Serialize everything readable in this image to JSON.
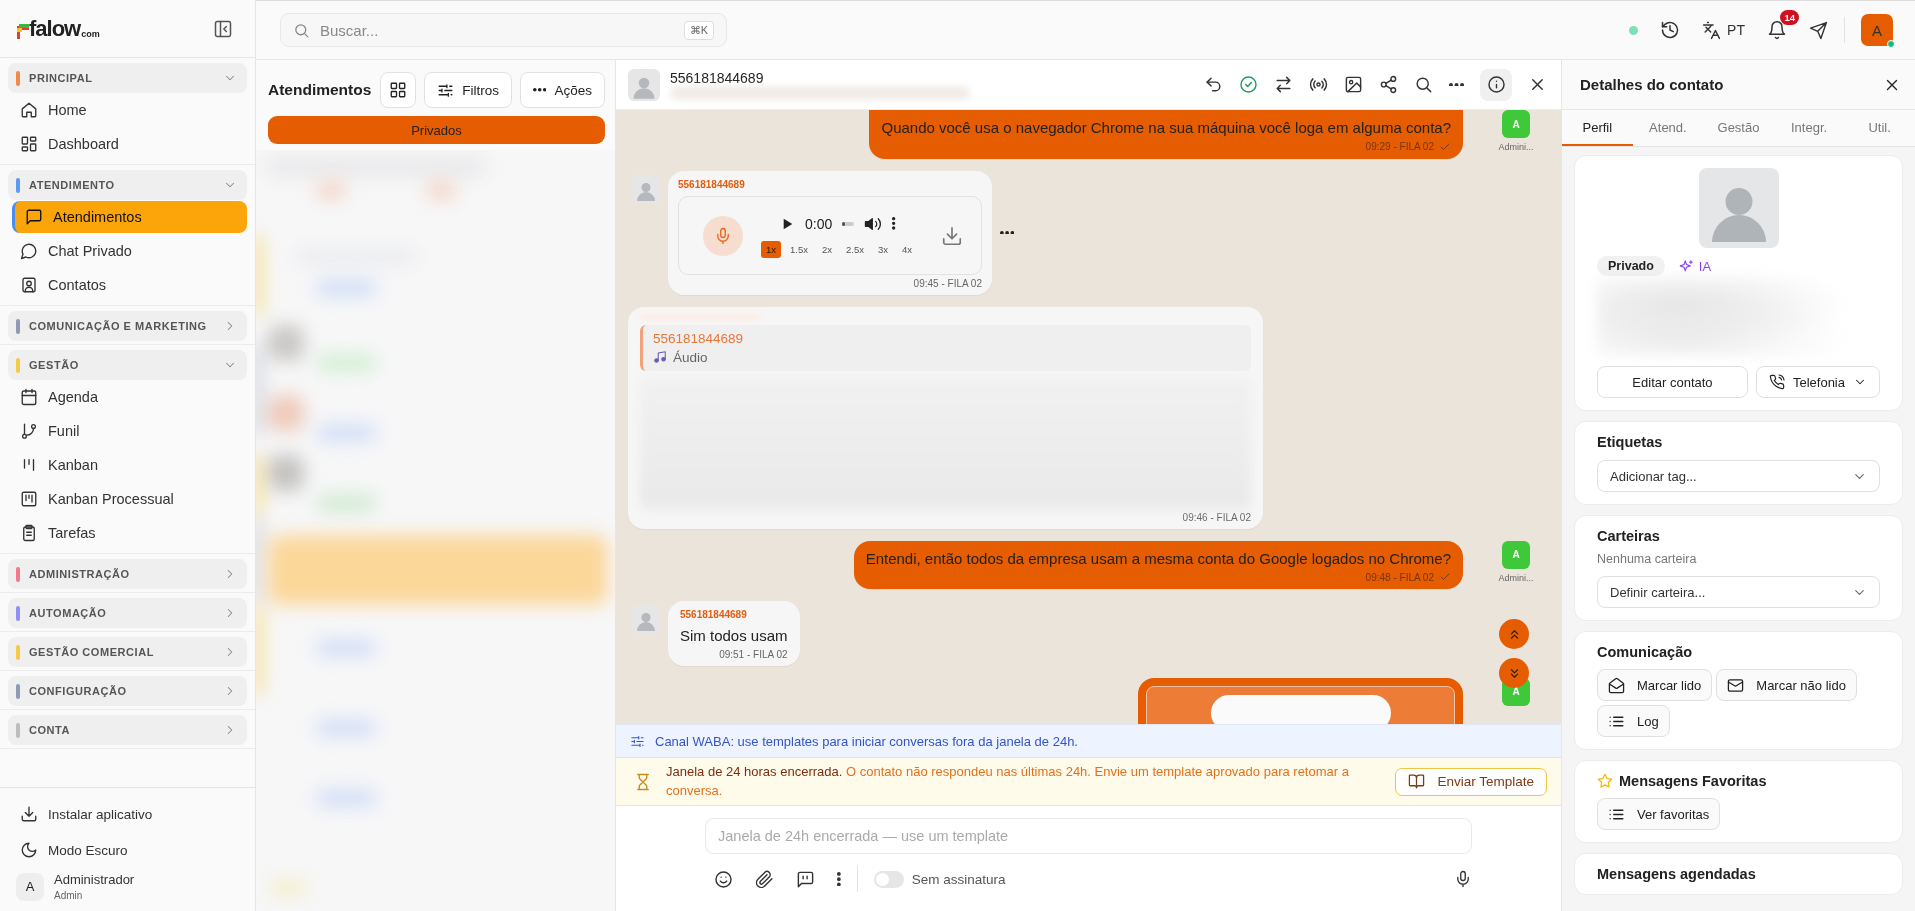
{
  "sidebar": {
    "logo": {
      "name": "falow",
      "suffix": "com"
    },
    "groups": [
      {
        "label": "PRINCIPAL",
        "color": "#f0894a",
        "expanded": true,
        "items": [
          {
            "label": "Home",
            "selected": false
          },
          {
            "label": "Dashboard",
            "selected": false
          }
        ]
      },
      {
        "label": "ATENDIMENTO",
        "color": "#5b9bf0",
        "expanded": true,
        "items": [
          {
            "label": "Atendimentos",
            "selected": true
          },
          {
            "label": "Chat Privado",
            "selected": false
          },
          {
            "label": "Contatos",
            "selected": false
          }
        ]
      },
      {
        "label": "COMUNICAÇÃO E MARKETING",
        "color": "#8d9bb3",
        "expanded": false
      },
      {
        "label": "GESTÃO",
        "color": "#f7c948",
        "expanded": true,
        "items": [
          {
            "label": "Agenda",
            "selected": false
          },
          {
            "label": "Funil",
            "selected": false
          },
          {
            "label": "Kanban",
            "selected": false
          },
          {
            "label": "Kanban Processual",
            "selected": false
          },
          {
            "label": "Tarefas",
            "selected": false
          }
        ]
      },
      {
        "label": "ADMINISTRAÇÃO",
        "color": "#f2788a",
        "expanded": false
      },
      {
        "label": "AUTOMAÇÃO",
        "color": "#8f8ff5",
        "expanded": false
      },
      {
        "label": "GESTÃO COMERCIAL",
        "color": "#f7c948",
        "expanded": false
      },
      {
        "label": "CONFIGURAÇÃO",
        "color": "#8d9bb3",
        "expanded": false
      },
      {
        "label": "CONTA",
        "color": "#bdbdbd",
        "expanded": false
      }
    ],
    "footer": [
      "Instalar aplicativo",
      "Modo Escuro"
    ],
    "user": {
      "initial": "A",
      "name": "Administrador",
      "role": "Admin"
    }
  },
  "topbar": {
    "search": {
      "placeholder": "Buscar...",
      "shortcut": "⌘K"
    },
    "language": "PT",
    "notifications": "14",
    "avatar": "A"
  },
  "conversations": {
    "title": "Atendimentos",
    "buttons": [
      "Filtros",
      "Ações"
    ],
    "filter": "Privados"
  },
  "chat": {
    "contact": "556181844689",
    "messages": [
      {
        "kind": "text_out",
        "text": "Quando você usa o navegador Chrome na sua máquina você loga em alguma conta?",
        "meta": "09:29 - FILA 02",
        "sent": true,
        "sender_initial": "A",
        "sender_label": "Admini..."
      },
      {
        "kind": "audio_in",
        "sender": "556181844689",
        "time": "0:00",
        "level": 0,
        "speeds": [
          {
            "label": "1x",
            "selected": true
          },
          {
            "label": "1.5x",
            "selected": false
          },
          {
            "label": "2x",
            "selected": false
          },
          {
            "label": "2.5x",
            "selected": false
          },
          {
            "label": "3x",
            "selected": false
          },
          {
            "label": "4x",
            "selected": false
          }
        ],
        "meta": "09:45 - FILA 02"
      },
      {
        "kind": "quote_in",
        "quote": {
          "sender": "556181844689",
          "text": "Áudio"
        },
        "meta": "09:46 - FILA 02"
      },
      {
        "kind": "text_out",
        "text": "Entendi, então todos da empresa usam a mesma conta do Google logados no Chrome?",
        "meta": "09:48 - FILA 02",
        "sent": true,
        "sender_initial": "A",
        "sender_label": "Admini..."
      },
      {
        "kind": "text_in",
        "sender": "556181844689",
        "text": "Sim todos usam",
        "meta": "09:51 - FILA 02"
      },
      {
        "kind": "audio_out_partial",
        "sender_initial": "A"
      }
    ],
    "channel_notice": "Canal WABA: use templates para iniciar conversas fora da janela de 24h.",
    "window_notice": {
      "text": "**Janela de 24 horas encerrada.** O contato não respondeu nas últimas 24h. Envie um template aprovado para retomar a conversa.",
      "button": "Enviar Template"
    },
    "composer": {
      "placeholder": "Janela de 24h encerrada — use um template",
      "signature": {
        "label": "Sem assinatura",
        "on": false
      }
    }
  },
  "contact_panel": {
    "title": "Detalhes do contato",
    "tabs": [
      {
        "label": "Perfil",
        "selected": true
      },
      {
        "label": "Atend.",
        "selected": false
      },
      {
        "label": "Gestão",
        "selected": false
      },
      {
        "label": "Integr.",
        "selected": false
      },
      {
        "label": "Util.",
        "selected": false
      }
    ],
    "profile": {
      "badges": [
        "Privado",
        "IA"
      ],
      "buttons": [
        "Editar contato",
        "Telefonia"
      ]
    },
    "sections": [
      {
        "kind": "select",
        "title": "Etiquetas",
        "placeholder": "Adicionar tag..."
      },
      {
        "kind": "select",
        "title": "Carteiras",
        "note": "Nenhuma carteira",
        "placeholder": "Definir carteira..."
      },
      {
        "kind": "actions",
        "title": "Comunicação",
        "buttons": [
          "Marcar lido",
          "Marcar não lido",
          "Log"
        ]
      },
      {
        "kind": "actions",
        "title": "Mensagens Favoritas",
        "buttons": [
          "Ver favoritas"
        ]
      },
      {
        "kind": "actions",
        "title": "Mensagens agendadas"
      }
    ]
  }
}
